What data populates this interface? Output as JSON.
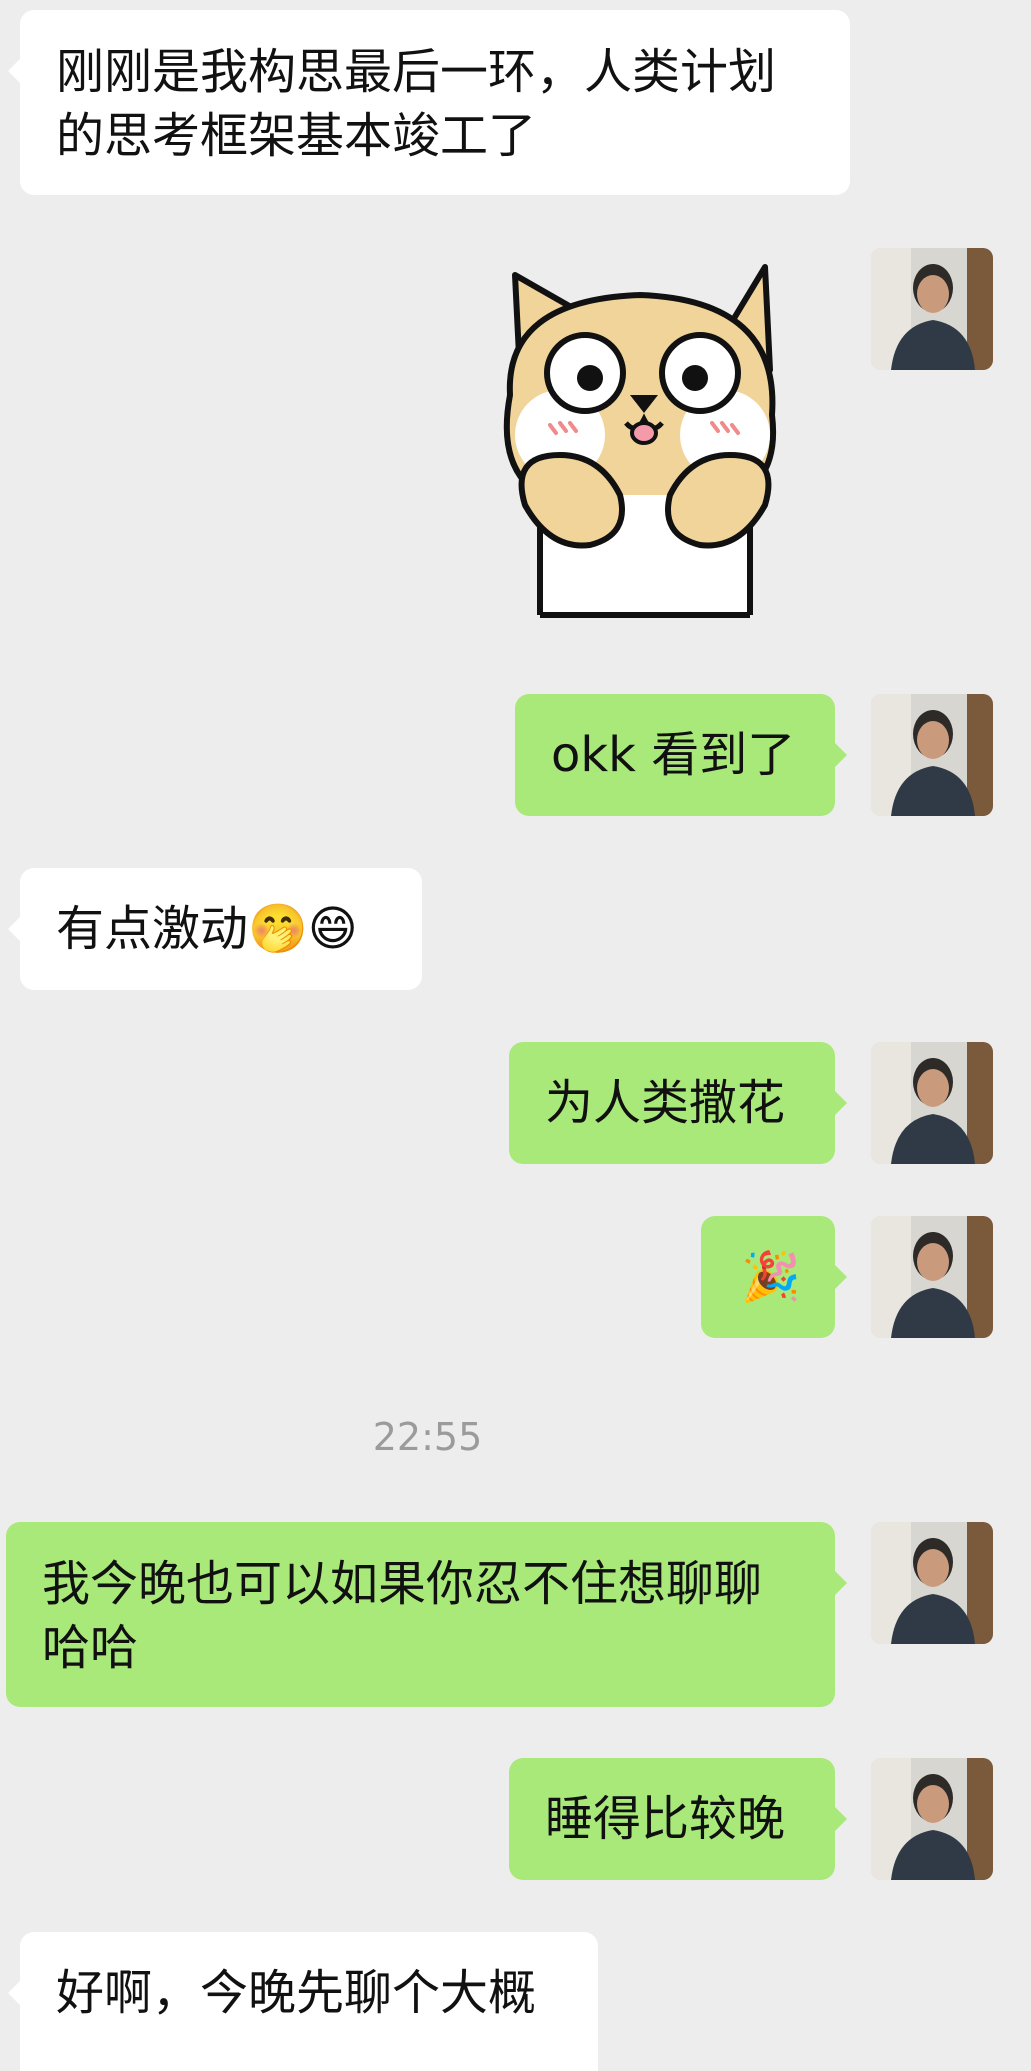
{
  "messages": [
    {
      "id": "m1",
      "side": "in",
      "text": "刚刚是我构思最后一环，人类计划的思考框架基本竣工了"
    },
    {
      "id": "m2",
      "side": "out",
      "type": "sticker",
      "sticker": "shiba-excited-sticker"
    },
    {
      "id": "m3",
      "side": "out",
      "text": "okk 看到了"
    },
    {
      "id": "m4",
      "side": "in",
      "text": "有点激动",
      "emoji": [
        "🤭",
        "😄"
      ]
    },
    {
      "id": "m5",
      "side": "out",
      "text": "为人类撒花"
    },
    {
      "id": "m6",
      "side": "out",
      "text": "🎉"
    },
    {
      "id": "m7",
      "side": "out",
      "text": "我今晚也可以如果你忍不住想聊聊哈哈"
    },
    {
      "id": "m8",
      "side": "out",
      "text": "睡得比较晚"
    },
    {
      "id": "m9",
      "side": "in",
      "text": "好啊，今晚先聊个大概"
    }
  ],
  "timestamp": "22:55",
  "colors": {
    "incoming_bubble": "#ffffff",
    "outgoing_bubble": "#a9e97a",
    "background": "#ededed"
  },
  "icons": {
    "avatar": "avatar-icon",
    "party": "party-popper-icon"
  }
}
